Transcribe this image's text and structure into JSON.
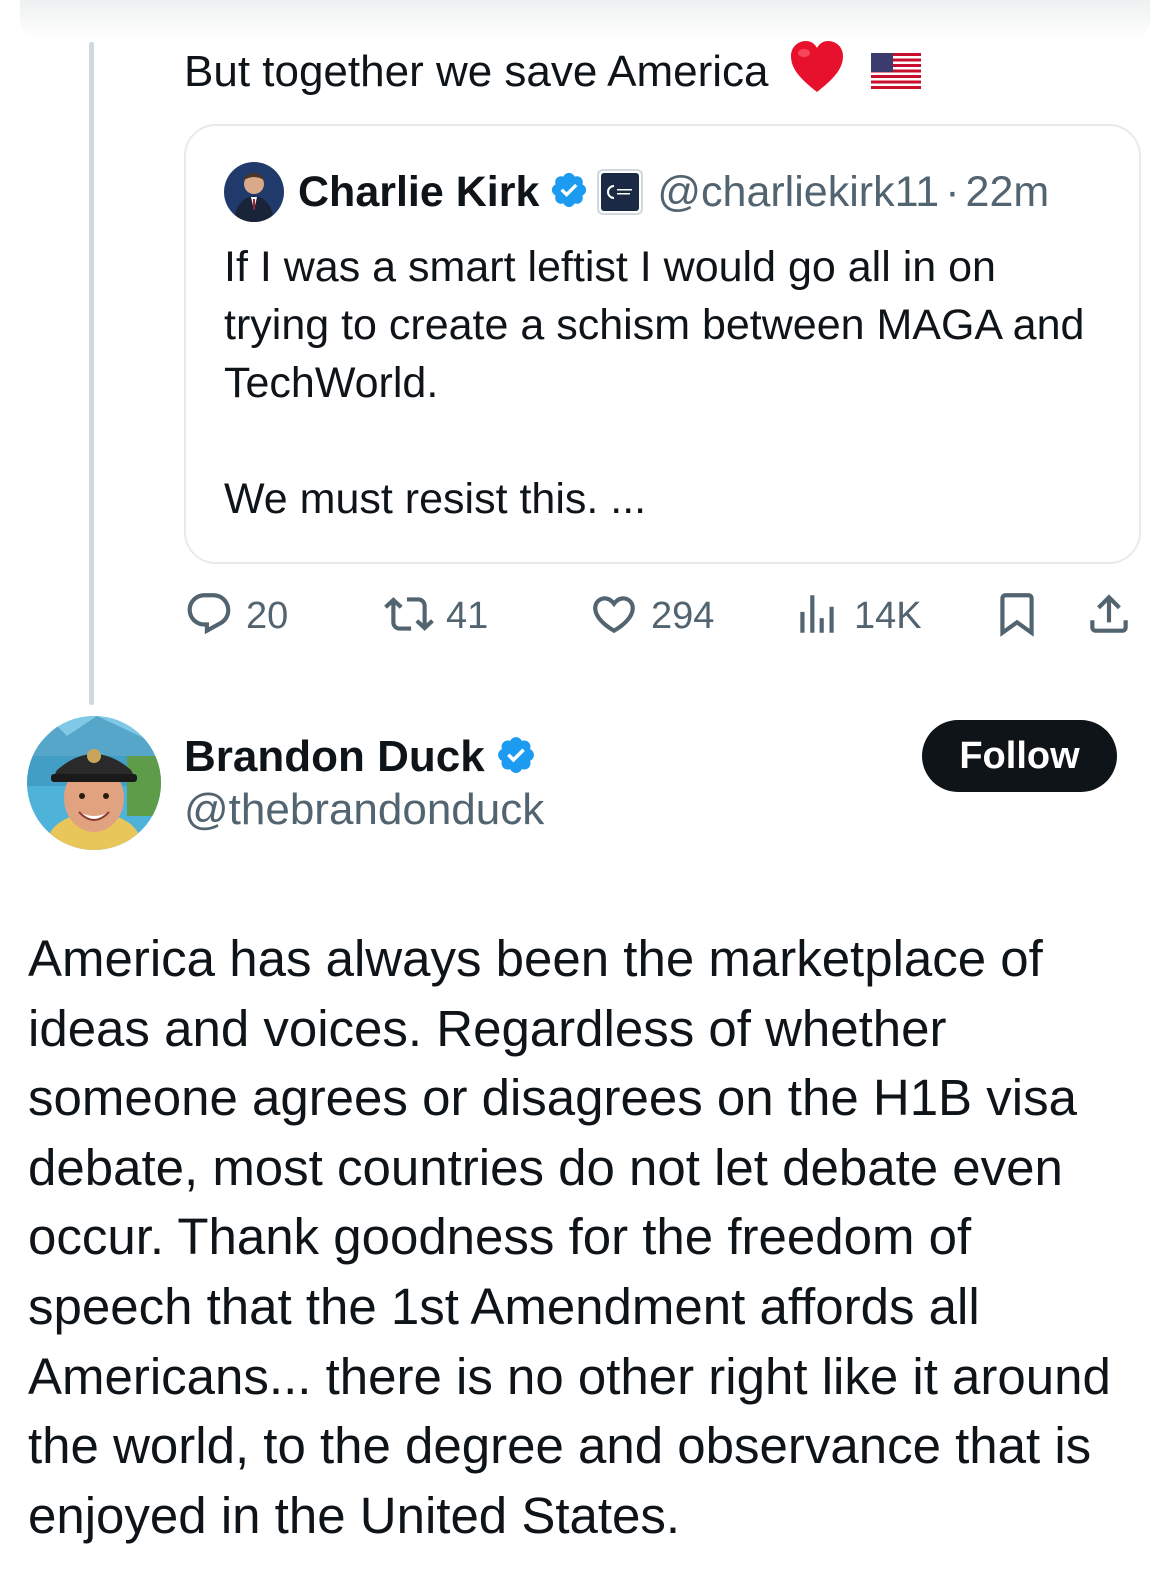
{
  "reply_tweet": {
    "text": "But together we save America",
    "emojis": [
      "red-heart",
      "us-flag"
    ]
  },
  "quoted_tweet": {
    "author_name": "Charlie Kirk",
    "handle": "@charliekirk11",
    "separator": "·",
    "time": "22m",
    "body_line1": "If I was a smart leftist I would go all in on trying to create a schism between MAGA and TechWorld.",
    "body_line2": "We must resist this. ..."
  },
  "actions": {
    "replies": "20",
    "reposts": "41",
    "likes": "294",
    "views": "14K"
  },
  "main_tweet": {
    "author_name": "Brandon Duck",
    "handle": "@thebrandonduck",
    "follow_label": "Follow",
    "body": "America has always been the marketplace of ideas and voices. Regardless of whether someone agrees or disagrees on the H1B visa debate, most countries do not let debate even occur. Thank goodness for the freedom of speech that the 1st Amendment affords all Americans... there is no other right like it around the world, to the degree and observance that is enjoyed in the United States."
  },
  "colors": {
    "text": "#0f1419",
    "secondary": "#536471",
    "verified_blue": "#1d9bf0",
    "thread_line": "#cfd9de",
    "button_bg": "#0f1419"
  },
  "icons": [
    "red-heart-emoji",
    "us-flag-emoji",
    "verified-badge-icon",
    "org-affiliation-icon",
    "reply-icon",
    "repost-icon",
    "like-icon",
    "views-icon",
    "bookmark-icon",
    "share-icon"
  ]
}
